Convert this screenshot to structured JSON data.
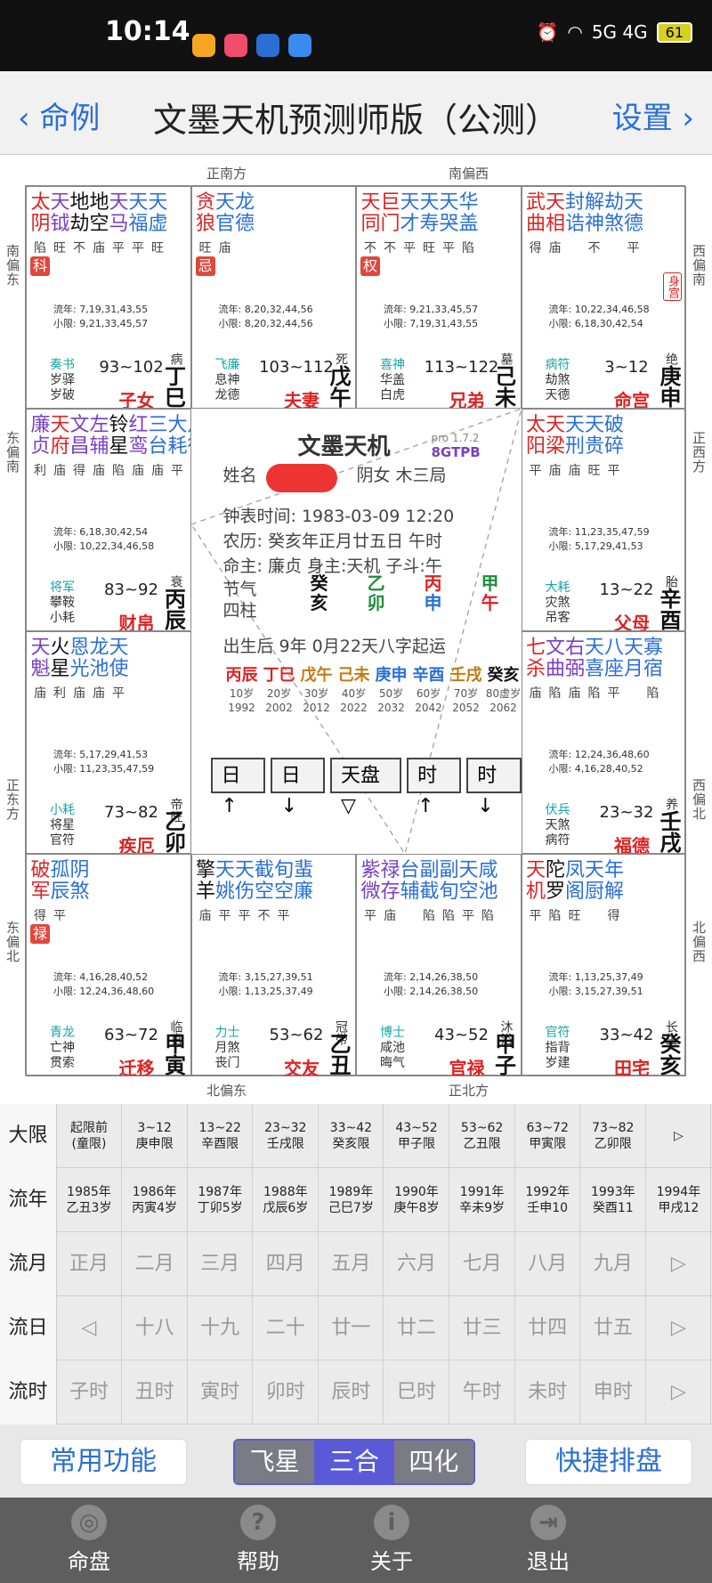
{
  "status": {
    "time": "10:14",
    "battery": "61",
    "signal": "5G 4G"
  },
  "header": {
    "back": "命例",
    "title": "文墨天机预测师版（公测）",
    "settings": "设置"
  },
  "directions": {
    "top_left": "正南方",
    "top_right": "南偏西",
    "bottom_left": "北偏东",
    "bottom_right": "正北方",
    "left": [
      "南偏东",
      "东偏南",
      "正东方",
      "东偏北"
    ],
    "right": [
      "西偏南",
      "正西方",
      "西偏北",
      "北偏西"
    ]
  },
  "palaces": [
    {
      "stars": [
        "太",
        "天",
        "地",
        "地",
        "天",
        "天",
        "天"
      ],
      "stars2": [
        "阴",
        "钺",
        "劫",
        "空",
        "马",
        "福",
        "虚"
      ],
      "colors": [
        "#d22",
        "#7a3fc3",
        "#111",
        "#111",
        "#7a3fc3",
        "#2a6fd6",
        "#2a6fd6"
      ],
      "bright": [
        "陷",
        "旺",
        "不",
        "庙",
        "平",
        "平",
        "旺"
      ],
      "hua": "科",
      "flow1": "流年: 7,19,31,43,55",
      "flow2": "小限: 9,21,33,45,57",
      "god1": "奏书",
      "god2": "岁驿",
      "god3": "岁破",
      "range": "93~102",
      "stage": "病",
      "name": "子女",
      "gz": "丁巳"
    },
    {
      "stars": [
        "贪",
        "天",
        "龙"
      ],
      "stars2": [
        "狼",
        "官",
        "德"
      ],
      "colors": [
        "#d22",
        "#2a6fd6",
        "#2a6fd6"
      ],
      "bright": [
        "旺",
        "庙",
        ""
      ],
      "hua": "忌",
      "flow1": "流年: 8,20,32,44,56",
      "flow2": "小限: 8,20,32,44,56",
      "god1": "飞廉",
      "god2": "息神",
      "god3": "龙德",
      "range": "103~112",
      "stage": "死",
      "name": "夫妻",
      "gz": "戊午"
    },
    {
      "stars": [
        "天",
        "巨",
        "天",
        "天",
        "天",
        "华"
      ],
      "stars2": [
        "同",
        "门",
        "才",
        "寿",
        "哭",
        "盖"
      ],
      "colors": [
        "#d22",
        "#d22",
        "#2a6fd6",
        "#2a6fd6",
        "#2a6fd6",
        "#2a6fd6"
      ],
      "bright": [
        "不",
        "不",
        "平",
        "旺",
        "平",
        "陷"
      ],
      "hua": "权",
      "flow1": "流年: 9,21,33,45,57",
      "flow2": "小限: 7,19,31,43,55",
      "god1": "喜神",
      "god2": "华盖",
      "god3": "白虎",
      "range": "113~122",
      "stage": "墓",
      "name": "兄弟",
      "gz": "己未"
    },
    {
      "stars": [
        "武",
        "天",
        "封",
        "解",
        "劫",
        "天"
      ],
      "stars2": [
        "曲",
        "相",
        "诰",
        "神",
        "煞",
        "德"
      ],
      "colors": [
        "#d22",
        "#d22",
        "#2a6fd6",
        "#2a6fd6",
        "#2a6fd6",
        "#2a6fd6"
      ],
      "bright": [
        "得",
        "庙",
        "",
        "不",
        "",
        "平"
      ],
      "hua": "",
      "flow1": "流年: 10,22,34,46,58",
      "flow2": "小限: 6,18,30,42,54",
      "god1": "病符",
      "god2": "劫煞",
      "god3": "天德",
      "range": "3~12",
      "stage": "绝",
      "name": "命宫",
      "gz": "庚申",
      "shen": "身宫"
    },
    {
      "stars": [
        "廉",
        "天",
        "文",
        "左",
        "铃",
        "红",
        "三",
        "大",
        "月"
      ],
      "stars2": [
        "贞",
        "府",
        "昌",
        "辅",
        "星",
        "鸾",
        "台",
        "耗",
        "德"
      ],
      "colors": [
        "#7a3fc3",
        "#d22",
        "#7a3fc3",
        "#7a3fc3",
        "#111",
        "#7a3fc3",
        "#2a6fd6",
        "#2a6fd6",
        "#2a6fd6"
      ],
      "bright": [
        "利",
        "庙",
        "得",
        "庙",
        "陷",
        "庙",
        "庙",
        "平",
        ""
      ],
      "hua": "",
      "flow1": "流年: 6,18,30,42,54",
      "flow2": "小限: 10,22,34,46,58",
      "god1": "将军",
      "god2": "攀鞍",
      "god3": "小耗",
      "range": "83~92",
      "stage": "衰",
      "name": "财帛",
      "gz": "丙辰"
    },
    {
      "stars": [
        "太",
        "天",
        "天",
        "天",
        "破"
      ],
      "stars2": [
        "阳",
        "梁",
        "刑",
        "贵",
        "碎"
      ],
      "colors": [
        "#d22",
        "#d22",
        "#2a6fd6",
        "#2a6fd6",
        "#2a6fd6"
      ],
      "bright": [
        "平",
        "庙",
        "庙",
        "旺",
        "平"
      ],
      "hua": "",
      "flow1": "流年: 11,23,35,47,59",
      "flow2": "小限: 5,17,29,41,53",
      "god1": "大耗",
      "god2": "灾煞",
      "god3": "吊客",
      "range": "13~22",
      "stage": "胎",
      "name": "父母",
      "gz": "辛酉"
    },
    {
      "stars": [
        "天",
        "火",
        "恩",
        "龙",
        "天"
      ],
      "stars2": [
        "魁",
        "星",
        "光",
        "池",
        "使"
      ],
      "colors": [
        "#7a3fc3",
        "#111",
        "#2a6fd6",
        "#2a6fd6",
        "#2a6fd6"
      ],
      "bright": [
        "庙",
        "利",
        "庙",
        "庙",
        "平"
      ],
      "hua": "",
      "flow1": "流年: 5,17,29,41,53",
      "flow2": "小限: 11,23,35,47,59",
      "god1": "小耗",
      "god2": "将星",
      "god3": "官符",
      "range": "73~82",
      "stage": "帝旺",
      "name": "疾厄",
      "gz": "乙卯"
    },
    {
      "stars": [
        "七",
        "文",
        "右",
        "天",
        "八",
        "天",
        "寡"
      ],
      "stars2": [
        "杀",
        "曲",
        "弼",
        "喜",
        "座",
        "月",
        "宿"
      ],
      "colors": [
        "#d22",
        "#7a3fc3",
        "#7a3fc3",
        "#2a6fd6",
        "#2a6fd6",
        "#2a6fd6",
        "#2a6fd6"
      ],
      "bright": [
        "庙",
        "陷",
        "庙",
        "陷",
        "平",
        "",
        "陷"
      ],
      "hua": "",
      "flow1": "流年: 12,24,36,48,60",
      "flow2": "小限: 4,16,28,40,52",
      "god1": "伏兵",
      "god2": "天煞",
      "god3": "病符",
      "range": "23~32",
      "stage": "养",
      "name": "福德",
      "gz": "壬戌"
    },
    {
      "stars": [
        "破",
        "孤",
        "阴"
      ],
      "stars2": [
        "军",
        "辰",
        "煞"
      ],
      "colors": [
        "#d22",
        "#2a6fd6",
        "#2a6fd6"
      ],
      "bright": [
        "得",
        "平",
        ""
      ],
      "hua": "禄",
      "flow1": "流年: 4,16,28,40,52",
      "flow2": "小限: 12,24,36,48,60",
      "god1": "青龙",
      "god2": "亡神",
      "god3": "贯索",
      "range": "63~72",
      "stage": "临官",
      "name": "迁移",
      "gz": "甲寅"
    },
    {
      "stars": [
        "擎",
        "天",
        "天",
        "截",
        "旬",
        "蜚"
      ],
      "stars2": [
        "羊",
        "姚",
        "伤",
        "空",
        "空",
        "廉"
      ],
      "colors": [
        "#111",
        "#2a6fd6",
        "#2a6fd6",
        "#2a6fd6",
        "#2a6fd6",
        "#2a6fd6"
      ],
      "bright": [
        "庙",
        "平",
        "平",
        "不",
        "平",
        ""
      ],
      "hua": "",
      "flow1": "流年: 3,15,27,39,51",
      "flow2": "小限: 1,13,25,37,49",
      "god1": "力士",
      "god2": "月煞",
      "god3": "丧门",
      "range": "53~62",
      "stage": "冠带",
      "name": "交友",
      "gz": "乙丑"
    },
    {
      "stars": [
        "紫",
        "禄",
        "台",
        "副",
        "副",
        "天",
        "咸"
      ],
      "stars2": [
        "微",
        "存",
        "辅",
        "截",
        "旬",
        "空",
        "池"
      ],
      "colors": [
        "#7a3fc3",
        "#7a3fc3",
        "#2a6fd6",
        "#2a6fd6",
        "#2a6fd6",
        "#2a6fd6",
        "#2a6fd6"
      ],
      "bright": [
        "平",
        "庙",
        "",
        "陷",
        "陷",
        "平",
        "陷"
      ],
      "hua": "",
      "flow1": "流年: 2,14,26,38,50",
      "flow2": "小限: 2,14,26,38,50",
      "god1": "博士",
      "god2": "咸池",
      "god3": "晦气",
      "range": "43~52",
      "stage": "沐浴",
      "name": "官禄",
      "gz": "甲子"
    },
    {
      "stars": [
        "天",
        "陀",
        "凤",
        "天",
        "年"
      ],
      "stars2": [
        "机",
        "罗",
        "阁",
        "厨",
        "解"
      ],
      "colors": [
        "#d22",
        "#111",
        "#2a6fd6",
        "#2a6fd6",
        "#2a6fd6"
      ],
      "bright": [
        "平",
        "陷",
        "旺",
        "",
        "得"
      ],
      "hua": "",
      "flow1": "流年: 1,13,25,37,49",
      "flow2": "小限: 3,15,27,39,51",
      "god1": "官符",
      "god2": "指背",
      "god3": "岁建",
      "range": "33~42",
      "stage": "长生",
      "name": "田宅",
      "gz": "癸亥"
    }
  ],
  "center": {
    "title": "文墨天机",
    "ver1": "pro 1.7.2",
    "ver2": "8GTPB",
    "name_label": "姓名",
    "gender": "阴女 木三局",
    "clock": "钟表时间: 1983-03-09 12:20",
    "lunar": "农历: 癸亥年正月廿五日 午时",
    "ming": "命主: 廉贞 身主:天机 子斗:午",
    "jieqi": "节气",
    "sizhu": "四柱",
    "pillar_top": [
      "癸",
      "乙",
      "丙",
      "甲"
    ],
    "pillar_bot": [
      "亥",
      "卯",
      "申",
      "午"
    ],
    "qiyun": "出生后 9年 0月22天八字起运",
    "dayun_gz": [
      "丙辰",
      "丁巳",
      "戊午",
      "己未",
      "庚申",
      "辛酉",
      "壬戌",
      "癸亥"
    ],
    "dayun_age": [
      "10岁",
      "20岁",
      "30岁",
      "40岁",
      "50岁",
      "60岁",
      "70岁",
      "80虚岁"
    ],
    "dayun_year": [
      "1992",
      "2002",
      "2012",
      "2022",
      "2032",
      "2042",
      "2052",
      "2062"
    ],
    "buttons": [
      "日↑",
      "日↓",
      "天盘▽",
      "时↑",
      "时↓"
    ]
  },
  "table": {
    "rows": [
      {
        "label": "大限",
        "cells": [
          [
            "起限前",
            "(童限)"
          ],
          [
            "3~12",
            "庚申限"
          ],
          [
            "13~22",
            "辛酉限"
          ],
          [
            "23~32",
            "壬戌限"
          ],
          [
            "33~42",
            "癸亥限"
          ],
          [
            "43~52",
            "甲子限"
          ],
          [
            "53~62",
            "乙丑限"
          ],
          [
            "63~72",
            "甲寅限"
          ],
          [
            "73~82",
            "乙卯限"
          ],
          [
            "▷",
            ""
          ]
        ]
      },
      {
        "label": "流年",
        "cells": [
          [
            "1985年",
            "乙丑3岁"
          ],
          [
            "1986年",
            "丙寅4岁"
          ],
          [
            "1987年",
            "丁卯5岁"
          ],
          [
            "1988年",
            "戊辰6岁"
          ],
          [
            "1989年",
            "己巳7岁"
          ],
          [
            "1990年",
            "庚午8岁"
          ],
          [
            "1991年",
            "辛未9岁"
          ],
          [
            "1992年",
            "壬申10"
          ],
          [
            "1993年",
            "癸酉11"
          ],
          [
            "1994年",
            "甲戌12"
          ]
        ]
      },
      {
        "label": "流月",
        "cells": [
          [
            "正月"
          ],
          [
            "二月"
          ],
          [
            "三月"
          ],
          [
            "四月"
          ],
          [
            "五月"
          ],
          [
            "六月"
          ],
          [
            "七月"
          ],
          [
            "八月"
          ],
          [
            "九月"
          ],
          [
            "▷"
          ]
        ]
      },
      {
        "label": "流日",
        "cells": [
          [
            "◁"
          ],
          [
            "十八"
          ],
          [
            "十九"
          ],
          [
            "二十"
          ],
          [
            "廿一"
          ],
          [
            "廿二"
          ],
          [
            "廿三"
          ],
          [
            "廿四"
          ],
          [
            "廿五"
          ],
          [
            "▷"
          ]
        ]
      },
      {
        "label": "流时",
        "cells": [
          [
            "子时"
          ],
          [
            "丑时"
          ],
          [
            "寅时"
          ],
          [
            "卯时"
          ],
          [
            "辰时"
          ],
          [
            "巳时"
          ],
          [
            "午时"
          ],
          [
            "未时"
          ],
          [
            "申时"
          ],
          [
            "▷"
          ]
        ]
      }
    ]
  },
  "actions": {
    "common": "常用功能",
    "seg": [
      "飞星",
      "三合",
      "四化"
    ],
    "quick": "快捷排盘"
  },
  "nav": [
    {
      "label": "命盘",
      "icon": "◎"
    },
    {
      "label": "帮助",
      "icon": "?"
    },
    {
      "label": "关于",
      "icon": "i"
    },
    {
      "label": "退出",
      "icon": "⇥"
    }
  ]
}
